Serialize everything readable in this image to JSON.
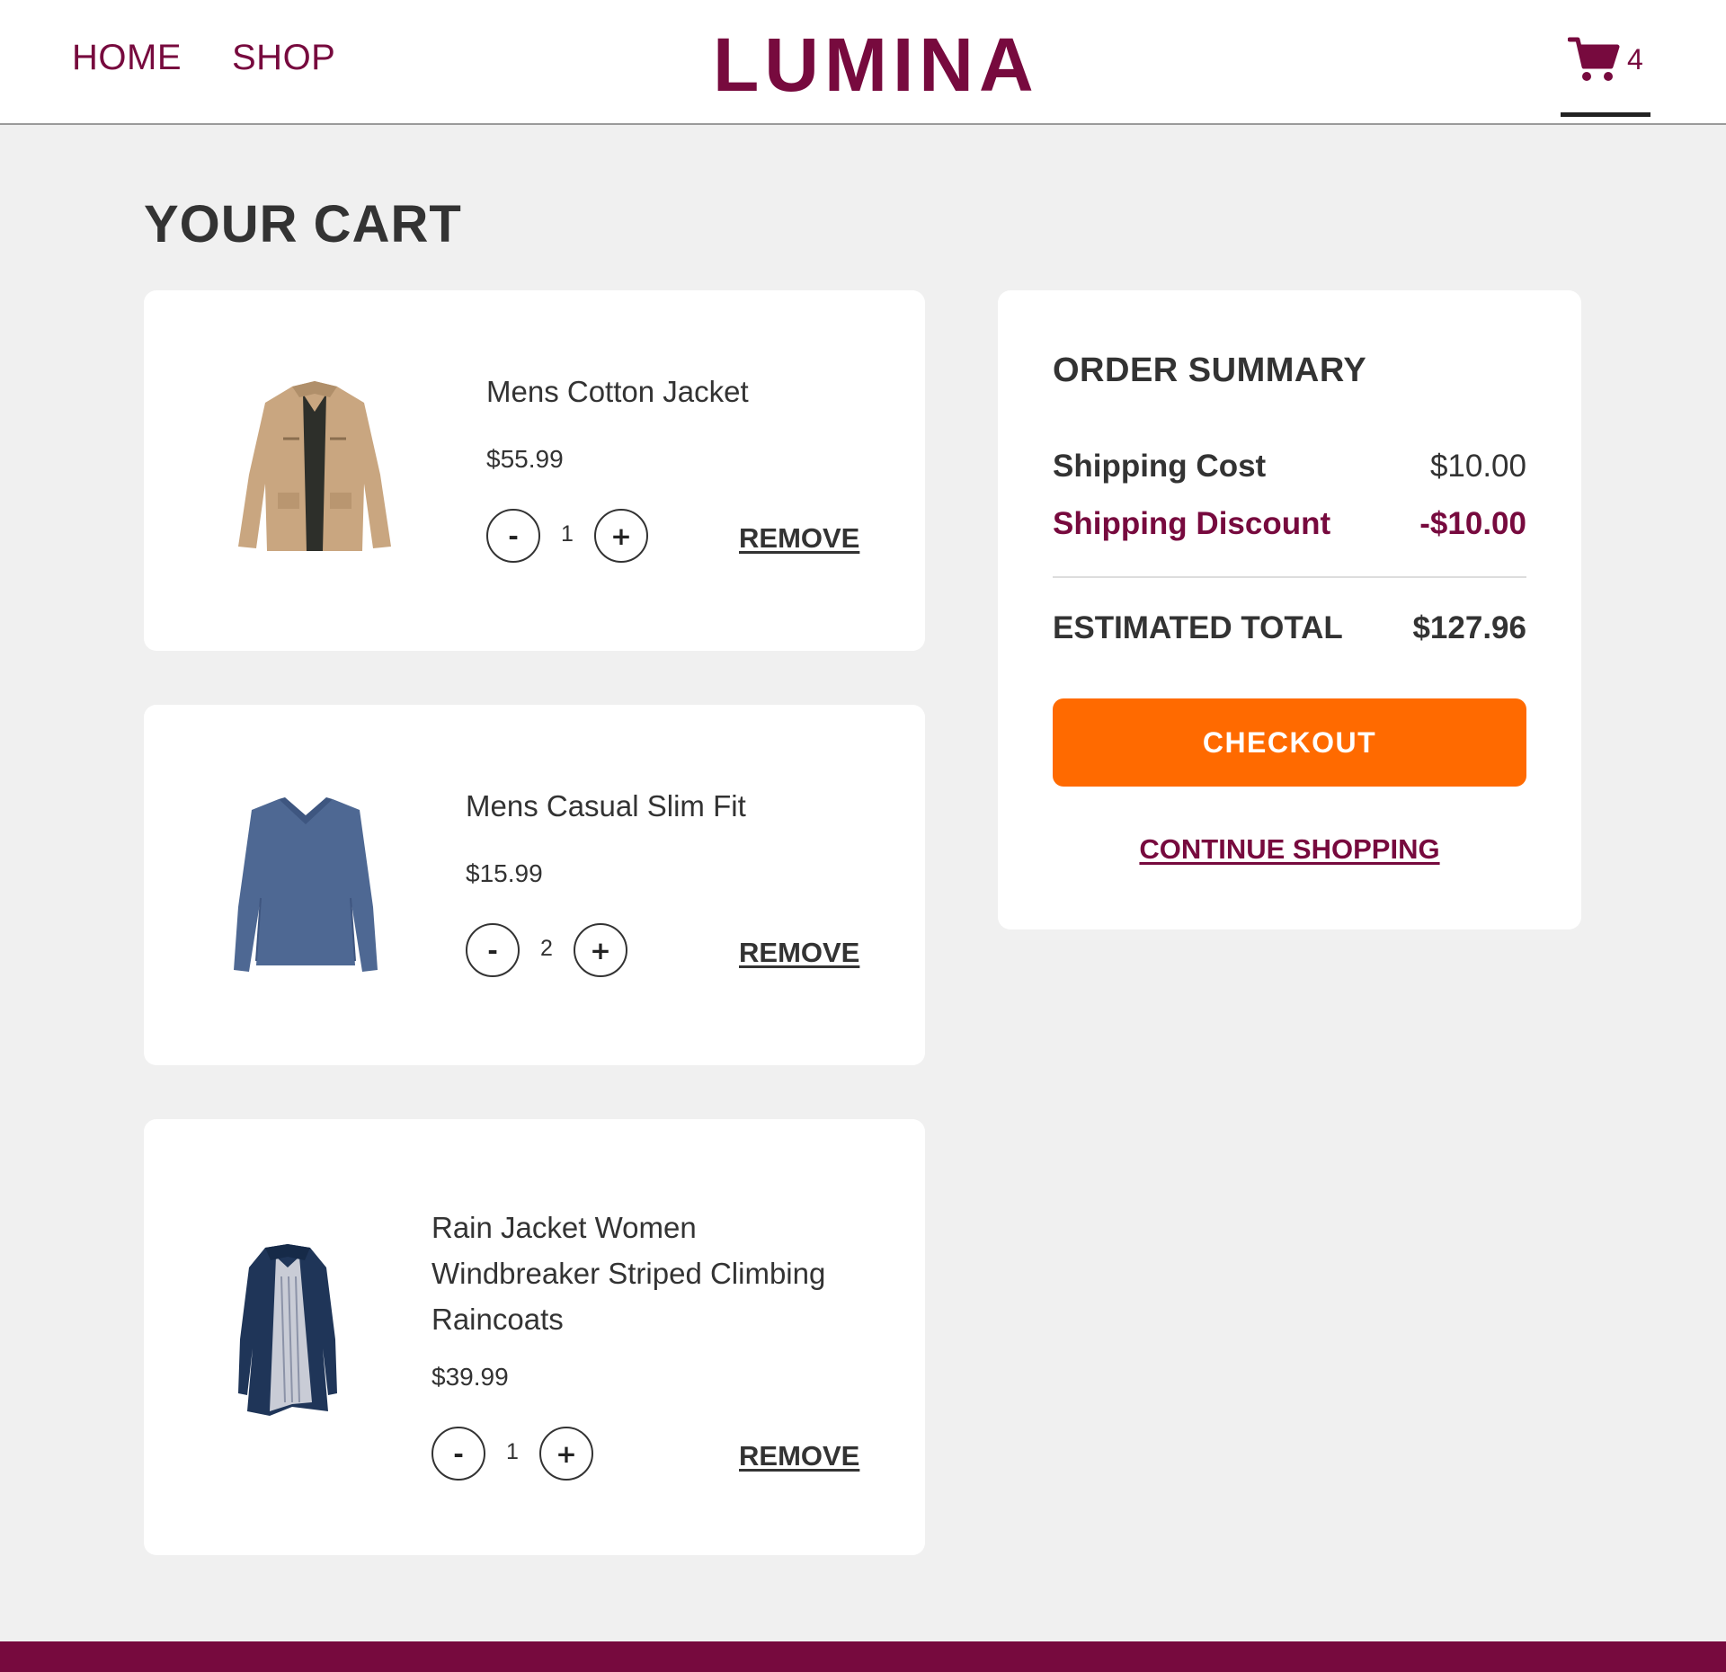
{
  "header": {
    "nav": {
      "home": "HOME",
      "shop": "SHOP"
    },
    "logo": "LUMINA",
    "cart_count": "4",
    "cart_icon": "shopping-cart-icon"
  },
  "page_title": "YOUR CART",
  "cart": {
    "items": [
      {
        "name": "Mens Cotton Jacket",
        "price": "$55.99",
        "quantity": "1",
        "minus": "-",
        "plus": "+",
        "remove": "REMOVE",
        "image": "tan-cotton-jacket"
      },
      {
        "name": "Mens Casual Slim Fit",
        "price": "$15.99",
        "quantity": "2",
        "minus": "-",
        "plus": "+",
        "remove": "REMOVE",
        "image": "blue-vneck-longsleeve"
      },
      {
        "name_lines": [
          "Rain Jacket Women",
          "Windbreaker Striped Climbing",
          "Raincoats"
        ],
        "price": "$39.99",
        "quantity": "1",
        "minus": "-",
        "plus": "+",
        "remove": "REMOVE",
        "image": "navy-rain-jacket"
      }
    ]
  },
  "summary": {
    "title": "ORDER SUMMARY",
    "shipping_cost_label": "Shipping Cost",
    "shipping_cost_value": "$10.00",
    "shipping_discount_label": "Shipping Discount",
    "shipping_discount_value": "-$10.00",
    "total_label": "ESTIMATED TOTAL",
    "total_value": "$127.96",
    "checkout": "CHECKOUT",
    "continue_shopping": "CONTINUE SHOPPING"
  },
  "colors": {
    "brand": "#770a3e",
    "checkout": "#ff6a00",
    "background": "#f0f0f0"
  }
}
